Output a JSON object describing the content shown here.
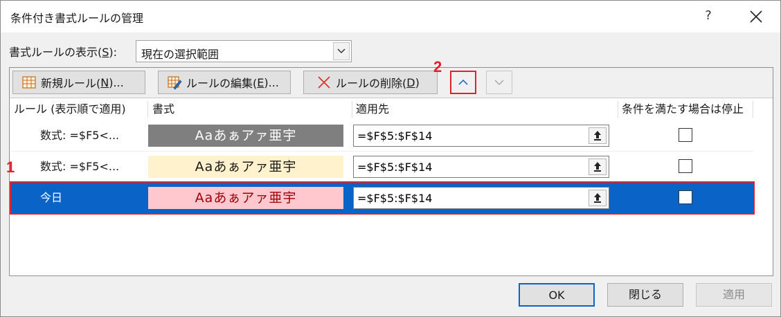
{
  "window": {
    "title": "条件付き書式ルールの管理",
    "help_label": "?"
  },
  "show_rules": {
    "label_prefix": "書式ルールの表示(",
    "label_accel": "S",
    "label_suffix": "):",
    "selected_value": "現在の選択範囲"
  },
  "toolbar": {
    "new_rule_prefix": "新規ルール(",
    "new_rule_accel": "N",
    "new_rule_suffix": ")...",
    "edit_rule_prefix": "ルールの編集(",
    "edit_rule_accel": "E",
    "edit_rule_suffix": ")...",
    "delete_rule_prefix": "ルールの削除(",
    "delete_rule_accel": "D",
    "delete_rule_suffix": ")"
  },
  "columns": {
    "rule": "ルール (表示順で適用)",
    "format": "書式",
    "applies_to": "適用先",
    "stop_if_true": "条件を満たす場合は停止"
  },
  "rules": [
    {
      "name": "数式: =$F5<...",
      "preview": "Aaあぁアァ亜宇",
      "applies_to": "=$F$5:$F$14",
      "stop_if_true": false,
      "preview_bg": "#7f7f7f",
      "preview_color": "#ffffff",
      "selected": false
    },
    {
      "name": "数式: =$F5<...",
      "preview": "Aaあぁアァ亜宇",
      "applies_to": "=$F$5:$F$14",
      "stop_if_true": false,
      "preview_bg": "#fff2cc",
      "preview_color": "#1a1a1a",
      "selected": false
    },
    {
      "name": "今日",
      "preview": "Aaあぁアァ亜宇",
      "applies_to": "=$F$5:$F$14",
      "stop_if_true": false,
      "preview_bg": "#ffc7ce",
      "preview_color": "#9c0006",
      "selected": true
    }
  ],
  "annotations": {
    "marker_1": "1",
    "marker_2": "2"
  },
  "footer": {
    "ok": "OK",
    "close": "閉じる",
    "apply": "適用"
  },
  "colors": {
    "selection": "#0a64c8",
    "annotation": "#e0202b"
  }
}
